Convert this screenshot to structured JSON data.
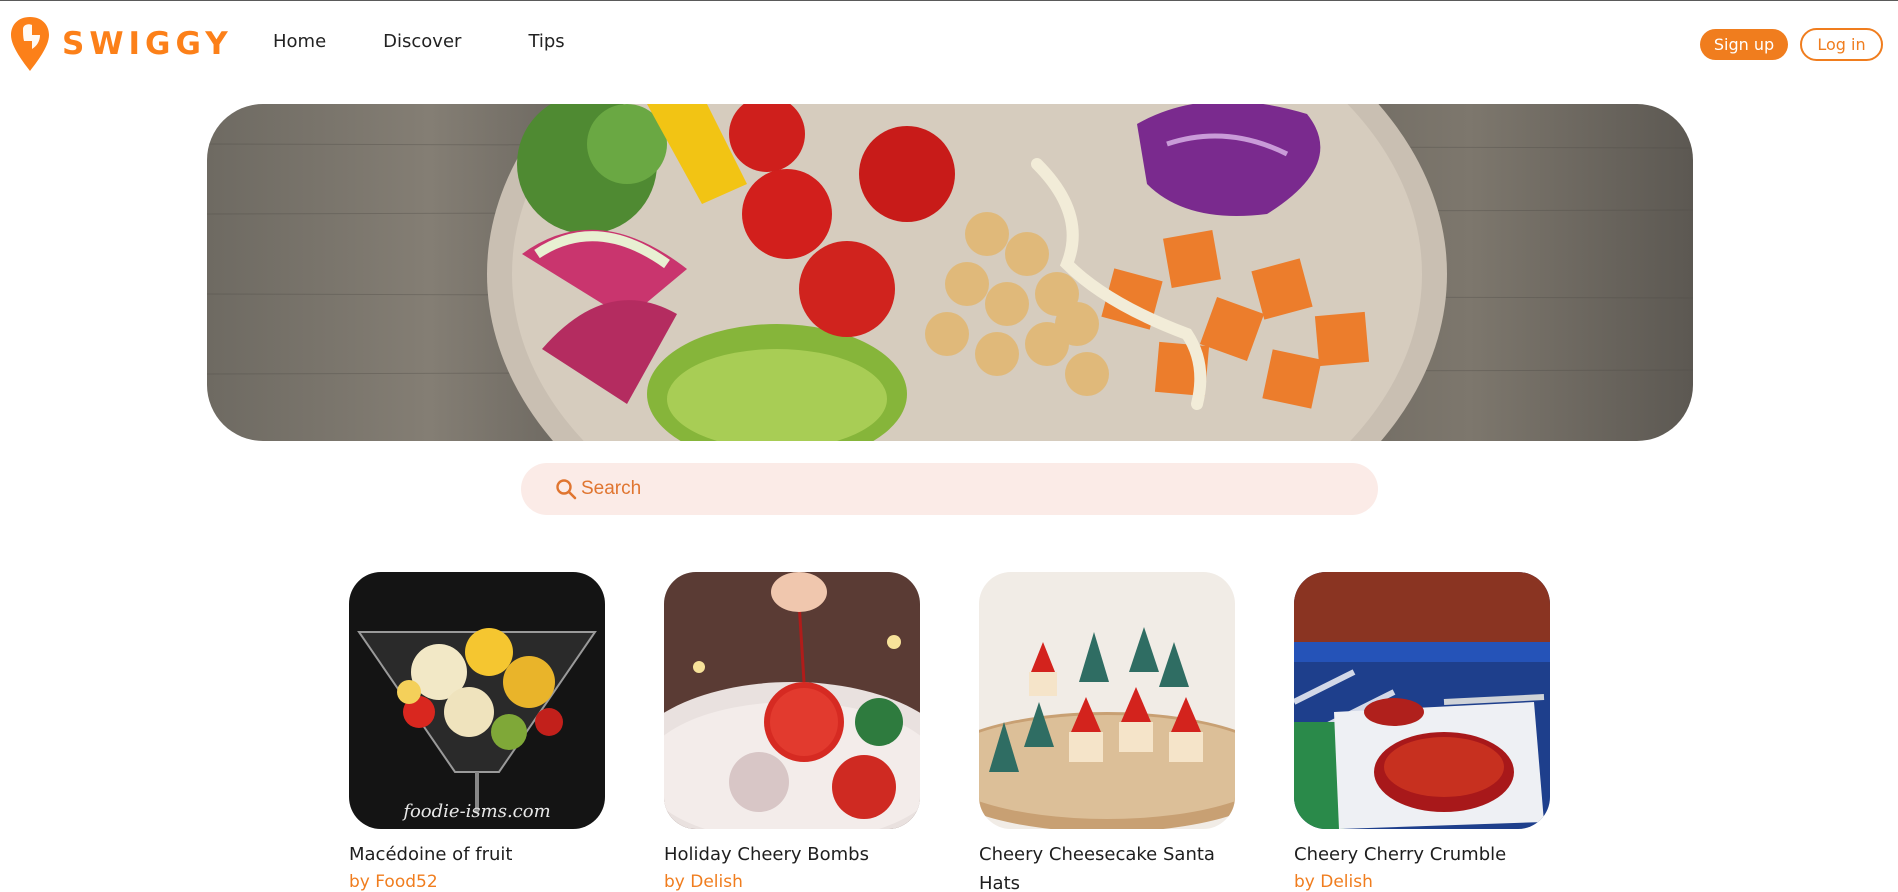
{
  "brand": {
    "name": "SWIGGY",
    "icon": "swiggy-logo-icon",
    "color": "#fc8019"
  },
  "nav": {
    "items": [
      {
        "label": "Home"
      },
      {
        "label": "Discover"
      },
      {
        "label": "Tips"
      }
    ]
  },
  "auth": {
    "signup_label": "Sign up",
    "login_label": "Log in"
  },
  "hero": {
    "alt": "hero-food-bowl-image"
  },
  "search": {
    "placeholder": "Search",
    "icon": "search-icon"
  },
  "recipes": [
    {
      "title": "Macédoine of fruit",
      "author": "by Food52",
      "watermark": "foodie-isms.com"
    },
    {
      "title": "Holiday Cheery Bombs",
      "author": "by Delish"
    },
    {
      "title": "Cheery Cheesecake Santa Hats",
      "author": ""
    },
    {
      "title": "Cheery Cherry Crumble",
      "author": "by Delish"
    }
  ],
  "colors": {
    "accent": "#f07d1e",
    "search_bg": "#fbebe7"
  }
}
